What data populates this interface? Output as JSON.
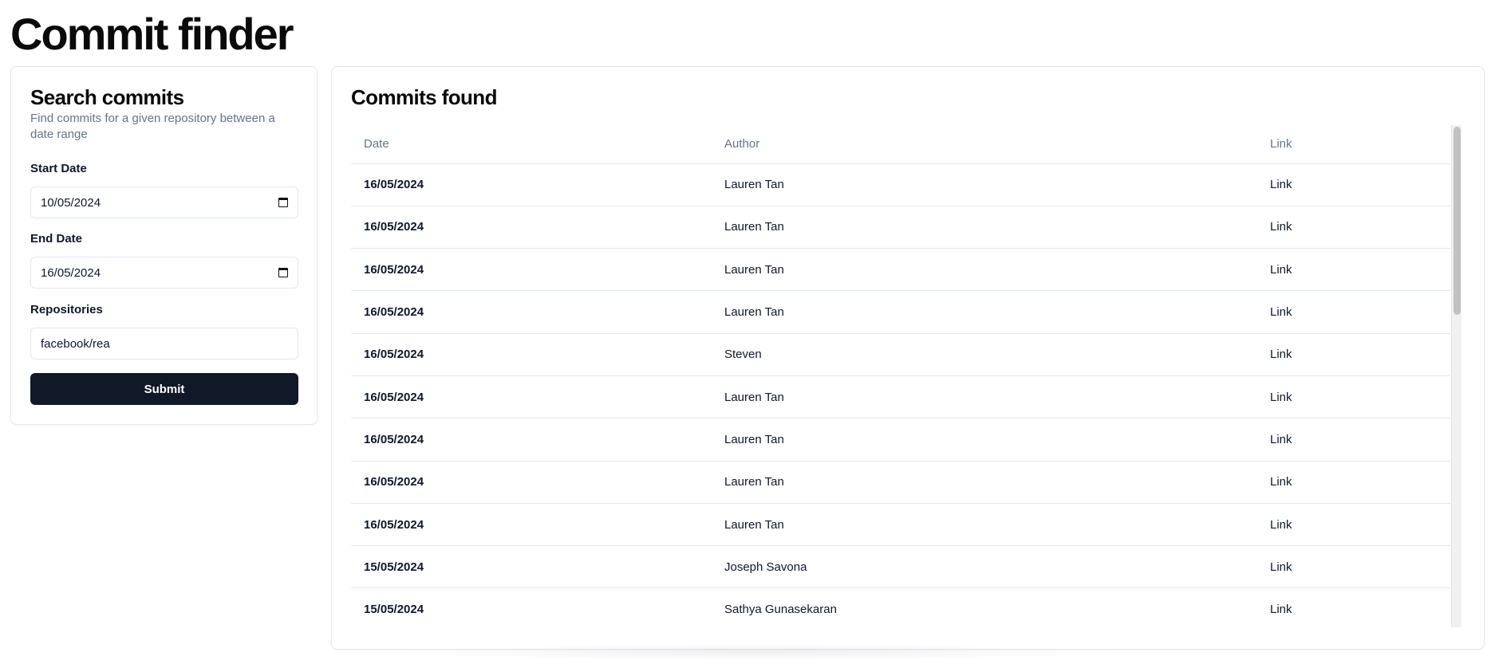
{
  "page": {
    "title": "Commit finder"
  },
  "search": {
    "title": "Search commits",
    "description": "Find commits for a given repository between a date range",
    "start_date": {
      "label": "Start Date",
      "value": "10/05/2024",
      "icon": "calendar-icon"
    },
    "end_date": {
      "label": "End Date",
      "value": "16/05/2024",
      "icon": "calendar-icon"
    },
    "repositories": {
      "label": "Repositories",
      "value": "facebook/rea"
    },
    "submit_label": "Submit"
  },
  "results": {
    "title": "Commits found",
    "columns": [
      "Date",
      "Author",
      "Link"
    ],
    "rows": [
      {
        "date": "16/05/2024",
        "author": "Lauren Tan",
        "link": "Link"
      },
      {
        "date": "16/05/2024",
        "author": "Lauren Tan",
        "link": "Link"
      },
      {
        "date": "16/05/2024",
        "author": "Lauren Tan",
        "link": "Link"
      },
      {
        "date": "16/05/2024",
        "author": "Lauren Tan",
        "link": "Link"
      },
      {
        "date": "16/05/2024",
        "author": "Steven",
        "link": "Link"
      },
      {
        "date": "16/05/2024",
        "author": "Lauren Tan",
        "link": "Link"
      },
      {
        "date": "16/05/2024",
        "author": "Lauren Tan",
        "link": "Link"
      },
      {
        "date": "16/05/2024",
        "author": "Lauren Tan",
        "link": "Link"
      },
      {
        "date": "16/05/2024",
        "author": "Lauren Tan",
        "link": "Link"
      },
      {
        "date": "15/05/2024",
        "author": "Joseph Savona",
        "link": "Link"
      },
      {
        "date": "15/05/2024",
        "author": "Sathya Gunasekaran",
        "link": "Link"
      }
    ]
  },
  "colors": {
    "primary_button": "#111827",
    "muted_text": "#64748b",
    "border": "#e2e8f0"
  }
}
